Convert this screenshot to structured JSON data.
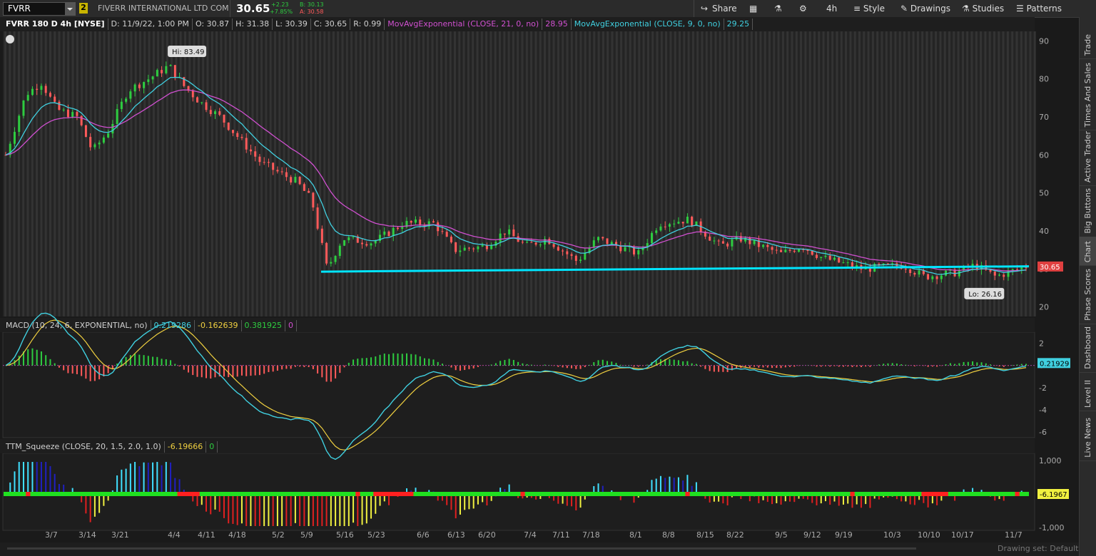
{
  "toolbar": {
    "symbol": "FVRR",
    "link_badge": "2",
    "company": "FIVERR INTERNATIONAL LTD COM",
    "last": "30.65",
    "change": "+2.23",
    "change_pct": "+7.85%",
    "bid": "B: 30.13",
    "ask": "A: 30.58",
    "share": "Share",
    "timeframe": "4h",
    "style": "Style",
    "drawings": "Drawings",
    "studies": "Studies",
    "patterns": "Patterns"
  },
  "right_tabs": [
    "Trade",
    "Times And Sales",
    "Active Trader",
    "Big Buttons",
    "Chart",
    "Phase Scores",
    "Dashboard",
    "Level II",
    "Live News"
  ],
  "price_legend": {
    "title": "FVRR 180 D 4h [NYSE]",
    "date": "D: 11/9/22, 1:00 PM",
    "open": "O: 30.87",
    "high": "H: 31.38",
    "low": "L: 30.39",
    "close": "C: 30.65",
    "range": "R: 0.99",
    "ema21_label": "MovAvgExponential (CLOSE, 21, 0, no)",
    "ema21_value": "28.95",
    "ema9_label": "MovAvgExponential (CLOSE, 9, 0, no)",
    "ema9_value": "29.25"
  },
  "macd_legend": {
    "label": "MACD (10, 24, 6, EXPONENTIAL, no)",
    "value": "0.219286",
    "avg": "-0.162639",
    "diff": "0.381925",
    "zero": "0"
  },
  "ttm_legend": {
    "label": "TTM_Squeeze (CLOSE, 20, 1.5, 2.0, 1.0)",
    "value": "-6.19666",
    "zero": "0"
  },
  "price_badge": "30.65",
  "macd_badge": "0.21929",
  "ttm_badge": "-6.1967",
  "hi_label": "Hi: 83.49",
  "lo_label": "Lo: 26.16",
  "drawing_set": "Drawing set: Default",
  "colors": {
    "up": "#2ecc40",
    "down": "#ff5a5a",
    "ema21": "#d050d0",
    "ema9": "#40d0e0",
    "support": "#00e5ff",
    "macd": "#40d0e0",
    "macd_avg": "#f0d040",
    "squeeze_on": "#ff2020",
    "squeeze_off": "#20e020"
  },
  "chart_data": [
    {
      "type": "candlestick",
      "name": "price",
      "x_ticks": [
        "3/7",
        "3/14",
        "3/21",
        "4/4",
        "4/11",
        "4/18",
        "5/2",
        "5/9",
        "5/16",
        "5/23",
        "6/6",
        "6/13",
        "6/20",
        "7/4",
        "7/11",
        "7/18",
        "8/1",
        "8/8",
        "8/15",
        "8/22",
        "9/5",
        "9/12",
        "9/19",
        "10/3",
        "10/10",
        "10/17",
        "11/7"
      ],
      "y_ticks": [
        20,
        30,
        40,
        50,
        60,
        70,
        80,
        90
      ],
      "ylim": [
        17.5,
        92.5
      ],
      "approx_close_path": [
        [
          0,
          60
        ],
        [
          0.02,
          76
        ],
        [
          0.035,
          79
        ],
        [
          0.05,
          72
        ],
        [
          0.07,
          70
        ],
        [
          0.085,
          61
        ],
        [
          0.1,
          66
        ],
        [
          0.12,
          77
        ],
        [
          0.14,
          80
        ],
        [
          0.16,
          83.49
        ],
        [
          0.175,
          78
        ],
        [
          0.19,
          74
        ],
        [
          0.21,
          70
        ],
        [
          0.23,
          64
        ],
        [
          0.25,
          58
        ],
        [
          0.27,
          55
        ],
        [
          0.285,
          53
        ],
        [
          0.3,
          48
        ],
        [
          0.315,
          30
        ],
        [
          0.33,
          38
        ],
        [
          0.36,
          37
        ],
        [
          0.39,
          42
        ],
        [
          0.42,
          42
        ],
        [
          0.44,
          35
        ],
        [
          0.47,
          36
        ],
        [
          0.49,
          40
        ],
        [
          0.51,
          36
        ],
        [
          0.53,
          38
        ],
        [
          0.56,
          32
        ],
        [
          0.58,
          38
        ],
        [
          0.6,
          36
        ],
        [
          0.62,
          34
        ],
        [
          0.64,
          42
        ],
        [
          0.67,
          43
        ],
        [
          0.7,
          36
        ],
        [
          0.72,
          38
        ],
        [
          0.76,
          34
        ],
        [
          0.78,
          36
        ],
        [
          0.8,
          33
        ],
        [
          0.84,
          30
        ],
        [
          0.88,
          31
        ],
        [
          0.9,
          28
        ],
        [
          0.93,
          29
        ],
        [
          0.95,
          31
        ],
        [
          0.97,
          28
        ],
        [
          1.0,
          30.65
        ]
      ],
      "ema21": {
        "label": "MovAvgExponential (CLOSE, 21, 0, no)",
        "last": 28.95
      },
      "ema9": {
        "label": "MovAvgExponential (CLOSE, 9, 0, no)",
        "last": 29.25
      },
      "support_line": 30.5,
      "hi": 83.49,
      "lo": 26.16,
      "last": 30.65
    },
    {
      "type": "line",
      "name": "macd",
      "y_ticks": [
        2,
        0,
        -2,
        -4,
        -6
      ],
      "ylim": [
        -6.5,
        3
      ],
      "last": 0.21929
    },
    {
      "type": "bar",
      "name": "ttm_squeeze",
      "y_ticks": [
        "1,000",
        "0",
        "-1,000"
      ],
      "last": -6.1967
    }
  ]
}
